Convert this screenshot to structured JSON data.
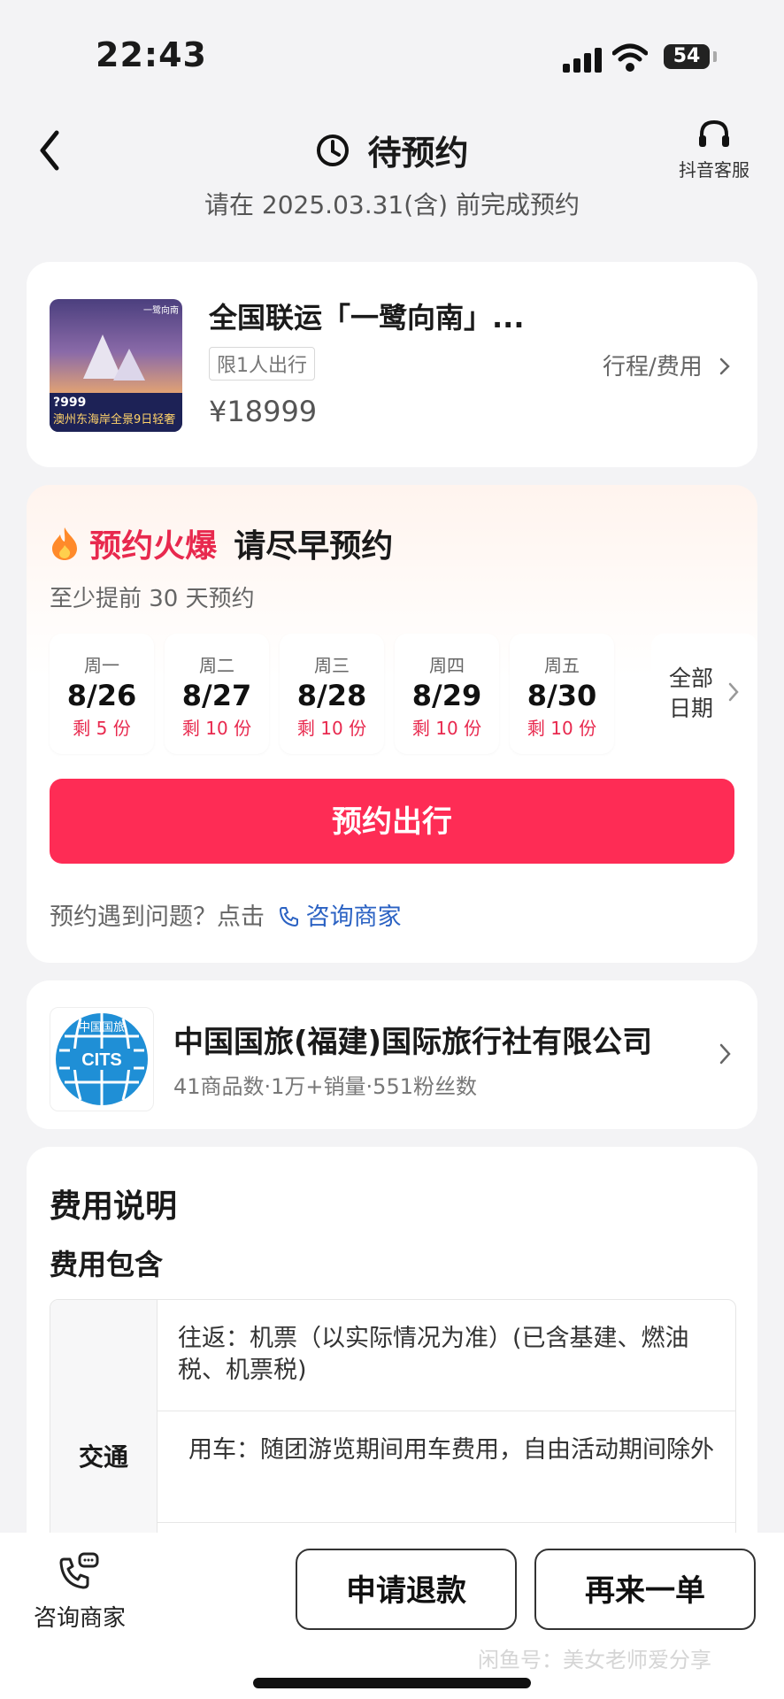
{
  "status_bar": {
    "time": "22:43",
    "battery": "54"
  },
  "nav": {
    "title": "待预约",
    "customer_service": "抖音客服"
  },
  "deadline": "请在 2025.03.31(含) 前完成预约",
  "product": {
    "name": "全国联运「一鹭向南」...",
    "tag": "限1人出行",
    "link": "行程/费用",
    "price": "¥18999",
    "thumb_price": "?999",
    "thumb_caption": "澳州东海岸全景9日轻奢",
    "thumb_corner": "一鹭向南"
  },
  "booking": {
    "hot_title": "预约火爆",
    "hot_sub": "请尽早预约",
    "advance": "至少提前 30 天预约",
    "dates": [
      {
        "weekday": "周一",
        "date": "8/26",
        "remaining": "剩 5 份"
      },
      {
        "weekday": "周二",
        "date": "8/27",
        "remaining": "剩 10 份"
      },
      {
        "weekday": "周三",
        "date": "8/28",
        "remaining": "剩 10 份"
      },
      {
        "weekday": "周四",
        "date": "8/29",
        "remaining": "剩 10 份"
      },
      {
        "weekday": "周五",
        "date": "8/30",
        "remaining": "剩 10 份"
      }
    ],
    "all_dates": "全部日期",
    "reserve_button": "预约出行",
    "help_text": "预约遇到问题？点击",
    "help_link": "咨询商家"
  },
  "merchant": {
    "name": "中国国旅(福建)国际旅行社有限公司",
    "meta": "41商品数·1万+销量·551粉丝数",
    "logo_text": "CITS",
    "logo_top": "中国国旅"
  },
  "fee": {
    "title": "费用说明",
    "subtitle": "费用包含",
    "category": "交通",
    "rows": [
      "往返：机票（以实际情况为准）(已含基建、燃油税、机票税)",
      "用车：随团游览期间用车费用，自由活动期间除外"
    ]
  },
  "bottom": {
    "consult": "咨询商家",
    "refund": "申请退款",
    "again": "再来一单",
    "watermark": "闲鱼号：美女老师爱分享"
  },
  "colors": {
    "accent": "#fe2c55",
    "hot": "#e8294e",
    "link": "#2b62c3"
  },
  "icons": [
    "back-arrow-icon",
    "clock-icon",
    "headset-icon",
    "fire-icon",
    "chevron-right-icon",
    "phone-chat-icon"
  ]
}
